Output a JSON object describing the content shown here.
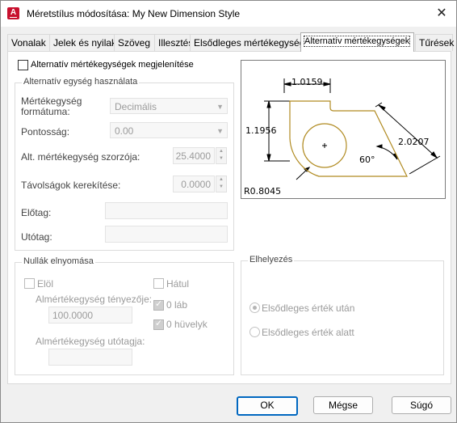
{
  "window": {
    "title": "Méretstílus módosítása: My New Dimension Style",
    "close": "✕"
  },
  "tabs": [
    "Vonalak",
    "Jelek és nyilak",
    "Szöveg",
    "Illesztés",
    "Elsődleges mértékegységek",
    "Alternatív mértékegységek",
    "Tűrések"
  ],
  "alt_units": {
    "display_label": "Alternatív mértékegységek megjelenítése",
    "group_title": "Alternatív egység használata",
    "unit_format_label": "Mértékegység\nformátuma:",
    "unit_format_value": "Decimális",
    "precision_label": "Pontosság:",
    "precision_value": "0.00",
    "multiplier_label": "Alt. mértékegység szorzója:",
    "multiplier_value": "25.4000",
    "round_label": "Távolságok kerekítése:",
    "round_value": "0.0000",
    "prefix_label": "Előtag:",
    "prefix_value": "",
    "suffix_label": "Utótag:",
    "suffix_value": ""
  },
  "zero_suppression": {
    "group_title": "Nullák elnyomása",
    "leading_label": "Elöl",
    "trailing_label": "Hátul",
    "subunit_factor_label": "Almértékegység tényezője:",
    "subunit_factor_value": "100.0000",
    "feet_label": "0 láb",
    "inches_label": "0 hüvelyk",
    "subunit_suffix_label": "Almértékegység utótagja:",
    "subunit_suffix_value": ""
  },
  "placement": {
    "group_title": "Elhelyezés",
    "after_label": "Elsődleges érték után",
    "below_label": "Elsődleges érték alatt",
    "selected": "after"
  },
  "preview": {
    "dim_top": "1.0159",
    "dim_left": "1.1956",
    "dim_right": "2.0207",
    "angle": "60°",
    "radius": "R0.8045"
  },
  "buttons": {
    "ok": "OK",
    "cancel": "Mégse",
    "help": "Súgó"
  },
  "colors": {
    "accent": "#0067c0",
    "preview_line": "#b08a20",
    "app_icon": "#c8102e"
  }
}
